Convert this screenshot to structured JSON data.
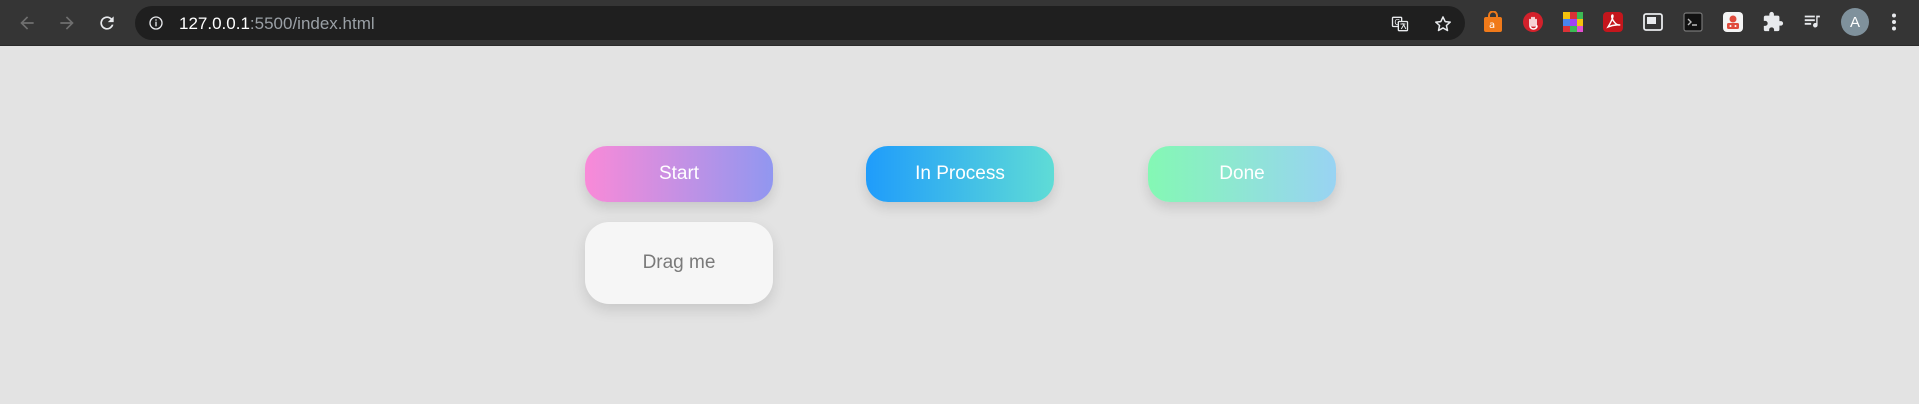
{
  "browser": {
    "url_host": "127.0.0.1",
    "url_path": ":5500/index.html",
    "profile_initial": "A",
    "icons": {
      "back": "back-arrow-icon",
      "forward": "forward-arrow-icon",
      "reload": "reload-icon",
      "site_info": "info-icon",
      "translate": "translate-icon",
      "bookmark": "star-icon",
      "extensions": [
        "shopping-bag-icon",
        "stop-hand-icon",
        "color-grid-icon",
        "pdf-icon",
        "picture-in-picture-icon",
        "terminal-icon",
        "robot-icon",
        "puzzle-icon",
        "media-queue-icon",
        "kebab-menu-icon"
      ]
    }
  },
  "board": {
    "columns": [
      {
        "label": "Start",
        "gradient": [
          "#f98ad8",
          "#9197f0"
        ]
      },
      {
        "label": "In Process",
        "gradient": [
          "#1f9cfb",
          "#5fdcd6"
        ]
      },
      {
        "label": "Done",
        "gradient": [
          "#84f8b4",
          "#99d3f3"
        ]
      }
    ],
    "draggable_card": {
      "label": "Drag me"
    }
  },
  "colors": {
    "page_background": "#e3e3e3",
    "chrome_background": "#353535",
    "omnibox_background": "#1f1f1f"
  }
}
